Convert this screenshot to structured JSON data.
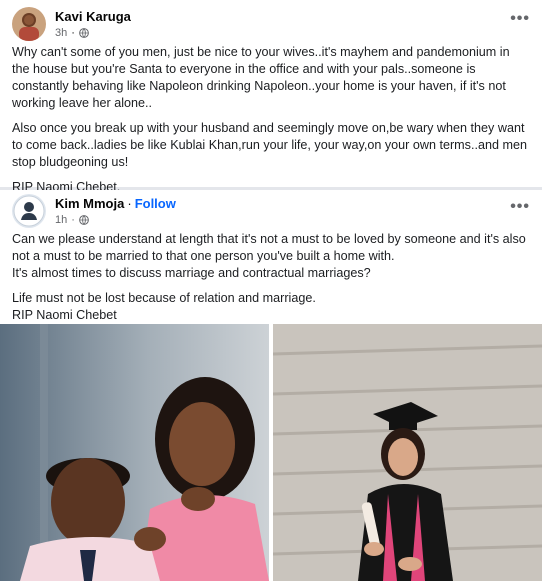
{
  "colors": {
    "link": "#0866ff",
    "meta": "#65676b"
  },
  "post1": {
    "author": "Kavi Karuga",
    "time": "3h",
    "privacy_icon": "globe-icon",
    "menu_label": "•••",
    "paragraphs": [
      "Why can't some of you men, just be nice to your wives..it's mayhem and pandemonium in the house but you're Santa to everyone in the office and with your pals..someone is constantly behaving like Napoleon drinking Napoleon..your home is your haven, if it's not working leave her alone..",
      "Also once you break up with your husband and seemingly move on,be wary when they want to come back..ladies be like Kublai Khan,run your life, your way,on your own terms..and men stop bludgeoning us!",
      "RIP Naomi Chebet."
    ]
  },
  "post2": {
    "author": "Kim Mmoja",
    "separator": "·",
    "follow_label": "Follow",
    "time": "1h",
    "privacy_icon": "globe-icon",
    "menu_label": "•••",
    "paragraph1_line1": "Can we please understand at length that it's not a must to be loved by someone and it's also not a must to be married to that one person you've built a home with.",
    "paragraph1_line2": "It's almost times to discuss marriage and contractual marriages?",
    "paragraph2_line1": "Life must not be lost because of relation and marriage.",
    "paragraph2_line2": "RIP Naomi Chebet"
  }
}
